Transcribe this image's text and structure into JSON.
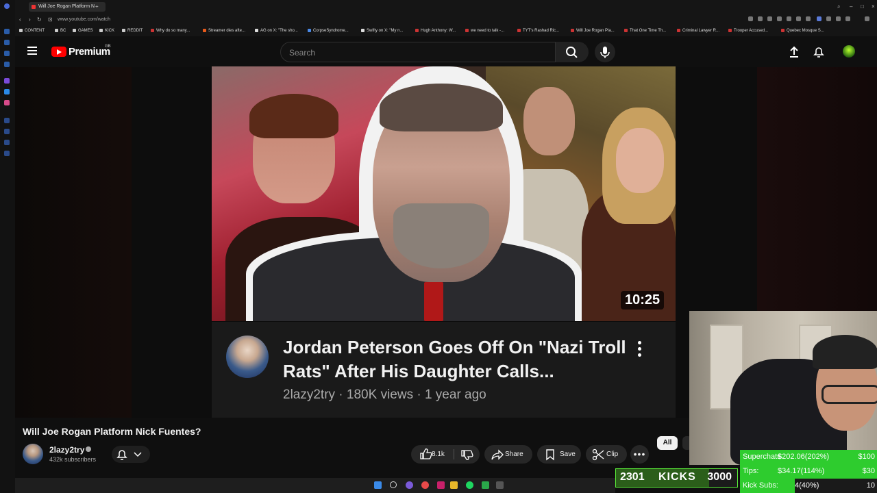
{
  "browser": {
    "tab_title": "Will Joe Rogan Platform N",
    "url": "www.youtube.com/watch",
    "bookmarks": [
      "CONTENT",
      "BC",
      "GAMES",
      "KICK",
      "REDDIT",
      "Why do so many...",
      "Streamer dies afte...",
      "AG on X: \"The sho...",
      "CorpseSyndrome...",
      "Swifty on X: \"My n...",
      "Hugh Anthony: W...",
      "we need to talk -...",
      "TYT's Rashad Ric...",
      "Will Joe Rogan Pla...",
      "That One Time Th...",
      "Criminal Lawyer R...",
      "Trooper Accused...",
      "Quebec Mosque S..."
    ]
  },
  "header": {
    "logo_text": "Premium",
    "region": "GB",
    "search_placeholder": "Search"
  },
  "thumbnail": {
    "duration": "10:25",
    "title": "Jordan Peterson Goes Off On \"Nazi Troll Rats\" After His Daughter Calls...",
    "meta": "2lazy2try · 180K views · 1 year ago"
  },
  "video": {
    "title": "Will Joe Rogan Platform Nick Fuentes?",
    "channel": "2lazy2try",
    "subscribers": "432k subscribers",
    "likes": "8.1k",
    "share_label": "Share",
    "save_label": "Save",
    "clip_label": "Clip",
    "chip_all": "All"
  },
  "overlay": {
    "kicks_current": "2301",
    "kicks_label": "KICKS",
    "kicks_goal": "3000",
    "kicks_progress": 0.767,
    "stats": [
      {
        "name": "Superchats",
        "value": "$202.06(202%)",
        "goal": "$100",
        "progress": 1.0
      },
      {
        "name": "Tips:",
        "value": "$34.17(114%)",
        "goal": "$30",
        "progress": 1.0
      },
      {
        "name": "Kick Subs:",
        "value": "4(40%)",
        "goal": "10",
        "progress": 0.4
      }
    ]
  },
  "colors": {
    "accent_red": "#ff0000",
    "overlay_green": "#2ecc2e"
  }
}
